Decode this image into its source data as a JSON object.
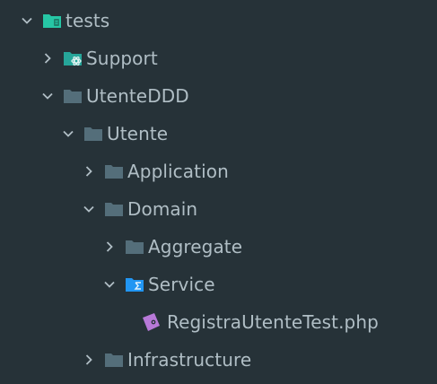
{
  "tree": {
    "colors": {
      "background": "#263238",
      "text": "#b0bec5",
      "folder": "#546e7a",
      "tests_folder": "#26c6a5",
      "support_folder": "#26a69a",
      "service_folder": "#2196f3",
      "php_file": "#b779d8"
    },
    "items": [
      {
        "label": "tests",
        "expanded": true,
        "icon": "test-folder-icon"
      },
      {
        "label": "Support",
        "expanded": false,
        "icon": "support-folder-icon"
      },
      {
        "label": "UtenteDDD",
        "expanded": true,
        "icon": "folder-icon"
      },
      {
        "label": "Utente",
        "expanded": true,
        "icon": "folder-icon"
      },
      {
        "label": "Application",
        "expanded": false,
        "icon": "folder-icon"
      },
      {
        "label": "Domain",
        "expanded": true,
        "icon": "folder-icon"
      },
      {
        "label": "Aggregate",
        "expanded": false,
        "icon": "folder-icon"
      },
      {
        "label": "Service",
        "expanded": true,
        "icon": "service-folder-icon"
      },
      {
        "label": "RegistraUtenteTest.php",
        "icon": "php-file-icon"
      },
      {
        "label": "Infrastructure",
        "expanded": false,
        "icon": "folder-icon"
      }
    ]
  }
}
